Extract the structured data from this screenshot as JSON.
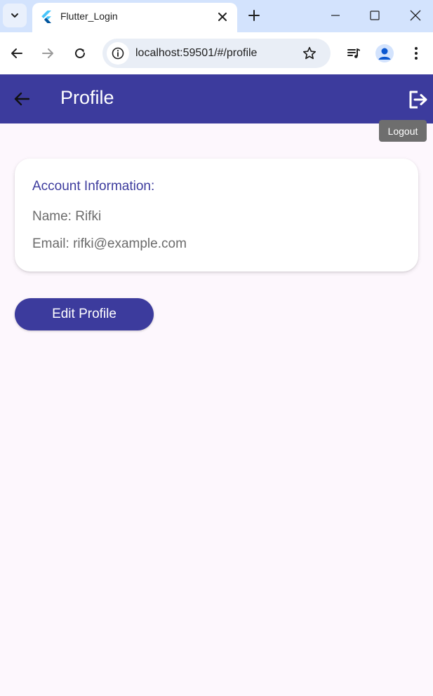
{
  "browser": {
    "tab_title": "Flutter_Login",
    "url": "localhost:59501/#/profile",
    "icons": {
      "tab_search": "chevron-down-icon",
      "favicon": "flutter-logo-icon",
      "tab_close": "close-icon",
      "new_tab": "plus-icon",
      "minimize": "minimize-icon",
      "maximize": "maximize-icon",
      "close_window": "close-icon",
      "back": "arrow-left-icon",
      "forward": "arrow-right-icon",
      "reload": "reload-icon",
      "site_info": "info-icon",
      "bookmark": "star-icon",
      "media": "media-playlist-icon",
      "profile": "person-icon",
      "menu": "kebab-menu-icon"
    }
  },
  "app": {
    "appbar": {
      "title": "Profile",
      "back_icon": "arrow-left-icon",
      "logout_icon": "logout-icon",
      "logout_tooltip": "Logout"
    },
    "account_card": {
      "heading": "Account Information:",
      "name_line": "Name: Rifki",
      "email_line": "Email: rifki@example.com"
    },
    "edit_button_label": "Edit Profile"
  },
  "colors": {
    "primary": "#3c3b9d",
    "background": "#fdf7fd",
    "tab_strip": "#d3e3fd",
    "tooltip": "#6e6e6e"
  }
}
